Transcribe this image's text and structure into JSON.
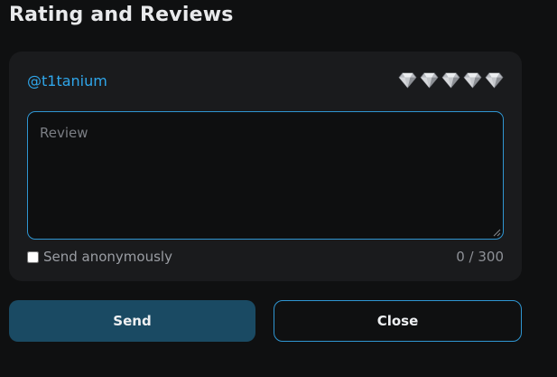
{
  "header": {
    "title": "Rating and Reviews"
  },
  "review_card": {
    "username": "@t1tanium",
    "rating": {
      "max": 5,
      "icon": "diamond-icon",
      "icon_color": "#c9ccd1"
    },
    "review_input": {
      "value": "",
      "placeholder": "Review"
    },
    "anonymous": {
      "label": "Send anonymously",
      "checked": false
    },
    "char_counter": "0 / 300"
  },
  "actions": {
    "send_label": "Send",
    "close_label": "Close"
  },
  "colors": {
    "accent": "#2f96d2",
    "username": "#2fa6ea",
    "send_bg": "#1a4a63",
    "card_bg": "#1a1b1d",
    "page_bg": "#0f1011"
  }
}
